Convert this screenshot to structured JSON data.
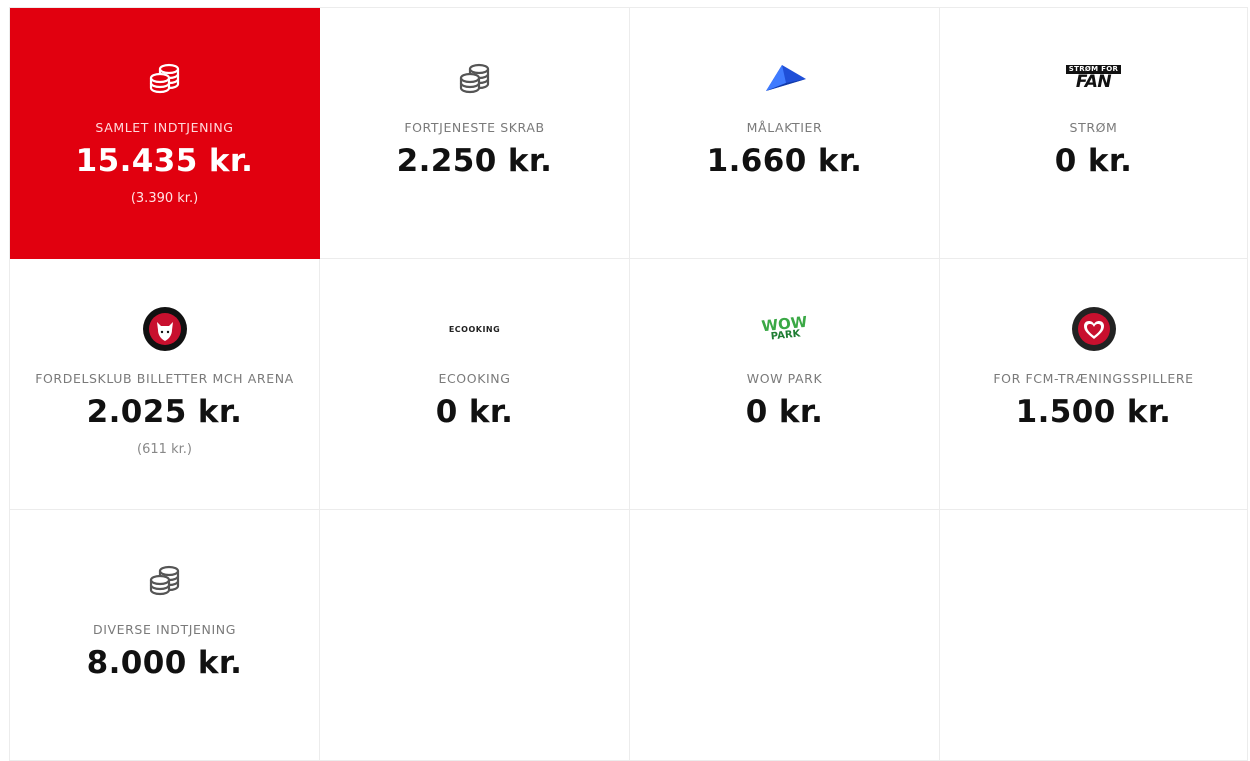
{
  "cards": [
    {
      "label": "SAMLET INDTJENING",
      "value": "15.435 kr.",
      "sub": "(3.390 kr.)",
      "icon": "coins-icon",
      "highlight": true,
      "accent": "#e1000f"
    },
    {
      "label": "FORTJENESTE SKRAB",
      "value": "2.250 kr.",
      "icon": "coins-icon"
    },
    {
      "label": "MÅLAKTIER",
      "value": "1.660 kr.",
      "icon": "malaktier-logo-icon"
    },
    {
      "label": "STRØM",
      "value": "0 kr.",
      "icon": "strom-for-fan-logo-icon",
      "logo_text_top": "STRØM FOR",
      "logo_text_bottom": "FAN"
    },
    {
      "label": "FORDELSKLUB BILLETTER MCH ARENA",
      "value": "2.025 kr.",
      "sub": "(611 kr.)",
      "icon": "fc-midtjylland-crest-icon"
    },
    {
      "label": "ECOOKING",
      "value": "0 kr.",
      "icon": "ecooking-logo-icon",
      "logo_text": "ECOOKING"
    },
    {
      "label": "WOW PARK",
      "value": "0 kr.",
      "icon": "wow-park-logo-icon",
      "logo_text_top": "WOW",
      "logo_text_bottom": "PARK"
    },
    {
      "label": "FOR FCM-TRÆNINGSSPILLERE",
      "value": "1.500 kr.",
      "icon": "heart-crest-icon"
    },
    {
      "label": "DIVERSE INDTJENING",
      "value": "8.000 kr.",
      "icon": "coins-icon"
    }
  ]
}
